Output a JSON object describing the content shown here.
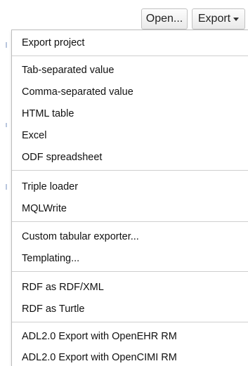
{
  "toolbar": {
    "open_label": "Open...",
    "export_label": "Export"
  },
  "menu": {
    "items": [
      "Export project",
      "Tab-separated value",
      "Comma-separated value",
      "HTML table",
      "Excel",
      "ODF spreadsheet",
      "Triple loader",
      "MQLWrite",
      "Custom tabular exporter...",
      "Templating...",
      "RDF as RDF/XML",
      "RDF as Turtle",
      "ADL2.0 Export with OpenEHR RM",
      "ADL2.0 Export with OpenCIMI RM"
    ]
  },
  "icons": {
    "export_caret": "chevron-down-icon"
  }
}
